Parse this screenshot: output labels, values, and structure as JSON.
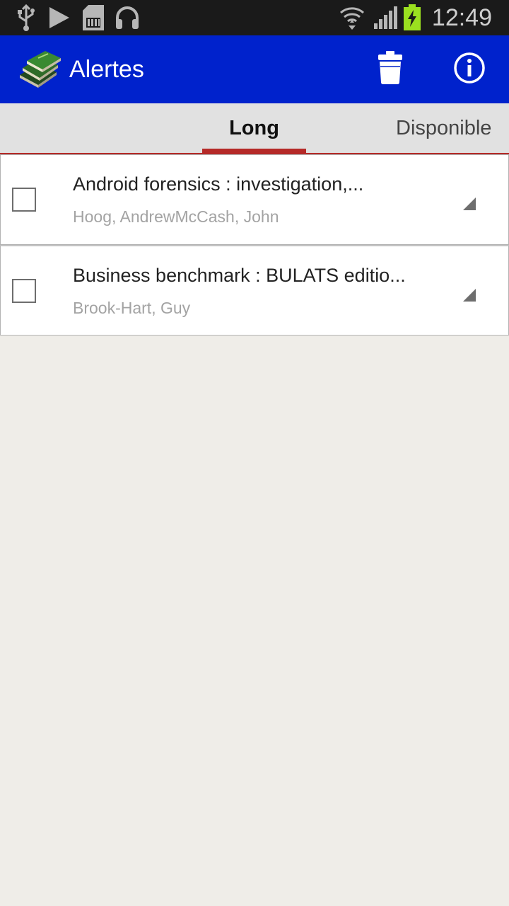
{
  "status_bar": {
    "time": "12:49",
    "icons": [
      "usb-icon",
      "play-store-icon",
      "sd-card-icon",
      "headphones-icon",
      "wifi-icon",
      "signal-icon",
      "battery-charging-icon"
    ]
  },
  "action_bar": {
    "title": "Alertes",
    "icons": [
      "app-books-icon",
      "trash-icon",
      "info-icon"
    ],
    "background_color": "#0022cc"
  },
  "tabs": [
    {
      "label": "Long",
      "selected": true
    },
    {
      "label": "Disponible",
      "selected": false
    }
  ],
  "accent_color": "#b52a28",
  "items": [
    {
      "title": "Android forensics : investigation,...",
      "author": "Hoog, AndrewMcCash, John",
      "checked": false
    },
    {
      "title": "Business benchmark : BULATS editio...",
      "author": "Brook-Hart, Guy",
      "checked": false
    }
  ]
}
